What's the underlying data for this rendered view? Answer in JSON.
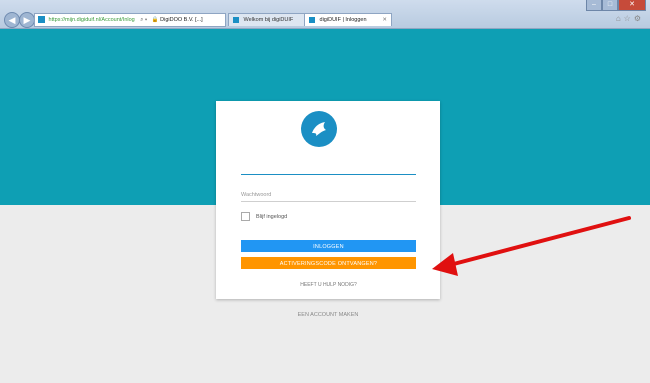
{
  "browser": {
    "address_url": "https://mijn.digiduif.nl/Account/Inlog",
    "address_site": "DigiDOO B.V. [...]",
    "tabs": [
      {
        "label": "Welkom bij digiDUIF"
      },
      {
        "label": "digiDUIF | Inloggen"
      }
    ]
  },
  "login": {
    "email_placeholder": "",
    "password_placeholder": "Wachtwoord",
    "remember_label": "Blijf ingelogd",
    "login_button": "INLOGGEN",
    "activation_button": "ACTIVERINGSCODE ONTVANGEN?",
    "help_link": "HEEFT U HULP NODIG?",
    "create_account_link": "EEN ACCOUNT MAKEN"
  },
  "colors": {
    "header_teal": "#0e9fb4",
    "logo_blue": "#1b8fc4",
    "login_blue": "#2196f3",
    "activation_orange": "#ff9500",
    "annotation_arrow": "#e01010"
  }
}
